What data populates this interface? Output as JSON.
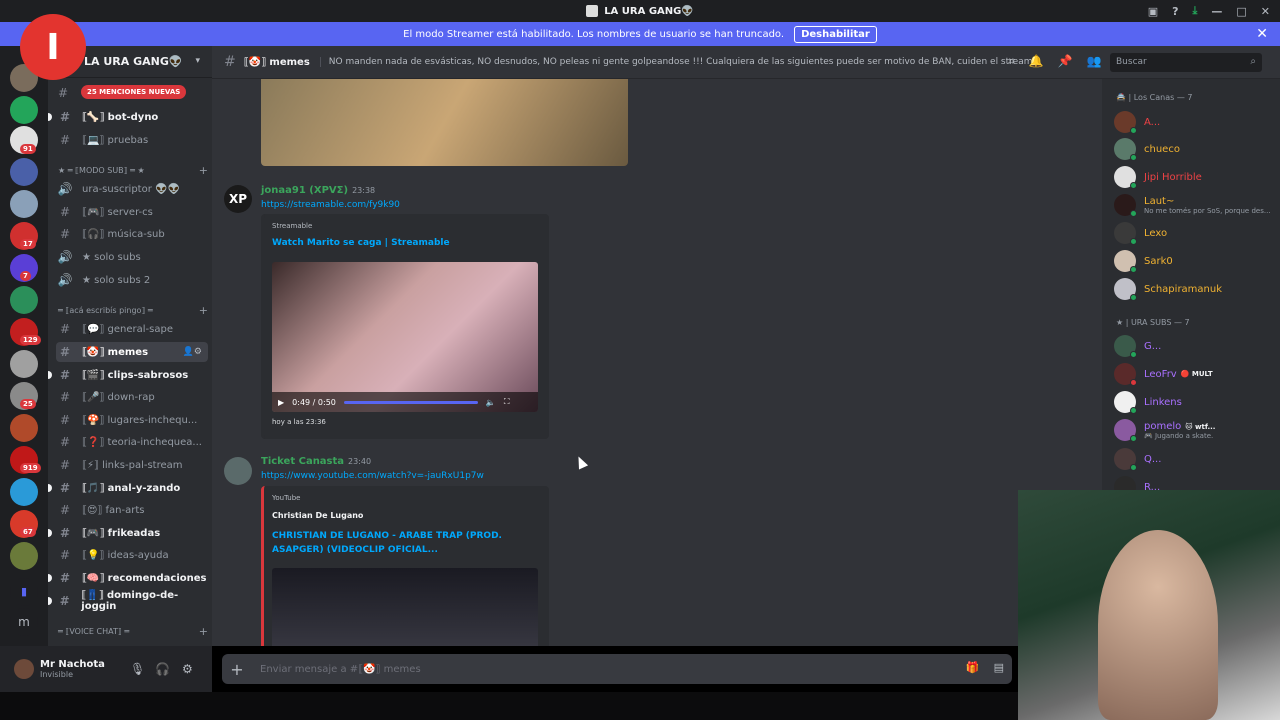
{
  "titlebar": {
    "title": "LA URA GANG👽"
  },
  "banner": {
    "text": "El modo Streamer está habilitado. Los nombres de usuario se han truncado.",
    "button": "Deshabilitar"
  },
  "guild_badges": [
    "91",
    "17",
    "7",
    "129",
    "25",
    "919",
    "67"
  ],
  "sidebar": {
    "server_name": "LA URA GANG👽",
    "mentions": "25 MENCIONES NUEVAS",
    "channels_top": [
      {
        "label": "⟦🦴⟧ bot-dyno",
        "unread": true
      },
      {
        "label": "⟦💻⟧ pruebas",
        "unread": false
      }
    ],
    "cat_sub": "★ ═ ⟦MODO SUB⟧ ═ ★",
    "channels_sub": [
      {
        "label": "ura-suscriptor 👽👽",
        "unread": false
      },
      {
        "label": "⟦🎮⟧ server-cs",
        "unread": false
      },
      {
        "label": "⟦🎧⟧ música-sub",
        "unread": false
      },
      {
        "label": "★ solo subs",
        "unread": false
      },
      {
        "label": "★ solo subs 2",
        "unread": false
      }
    ],
    "cat_pingo": "═ ⟦acá escribís pingo⟧ ═",
    "channels_pingo": [
      {
        "label": "⟦💬⟧ general-sape",
        "unread": false
      },
      {
        "label": "⟦🤡⟧ memes",
        "unread": true,
        "active": true
      },
      {
        "label": "⟦🎬⟧ clips-sabrosos",
        "unread": true
      },
      {
        "label": "⟦🎤⟧ down-rap",
        "unread": false
      },
      {
        "label": "⟦🍄⟧ lugares-inchequ...",
        "unread": false
      },
      {
        "label": "⟦❓⟧ teoria-inchequea...",
        "unread": false
      },
      {
        "label": "⟦⚡⟧ links-pal-stream",
        "unread": false
      },
      {
        "label": "⟦🎵⟧ anal-y-zando",
        "unread": true
      },
      {
        "label": "⟦😍⟧ fan-arts",
        "unread": false
      },
      {
        "label": "⟦🎮⟧ frikeadas",
        "unread": true
      },
      {
        "label": "⟦💡⟧ ideas-ayuda",
        "unread": false
      },
      {
        "label": "⟦🧠⟧ recomendaciones",
        "unread": true
      },
      {
        "label": "⟦👖⟧ domingo-de-joggin",
        "unread": true
      }
    ],
    "cat_voice": "═ ⟦VOICE CHAT⟧ ═"
  },
  "user": {
    "name": "Mr Nachota",
    "status": "Invisible"
  },
  "header": {
    "channel": "⟦🤡⟧ memes",
    "topic": "NO manden nada de esvásticas, NO desnudos, NO peleas ni gente golpeandose !!! Cualquiera de las siguientes puede ser motivo de BAN, cuiden el stream!",
    "search_placeholder": "Buscar"
  },
  "messages": [
    {
      "author": "jonaa91 (XPVΣ)",
      "time": "23:38",
      "color": "#3ba55c",
      "link": "https://streamable.com/fy9k90",
      "provider": "Streamable",
      "title": "Watch Marito se caga | Streamable",
      "video_time": "0:49 / 0:50",
      "footer": "hoy a las 23:36"
    },
    {
      "author": "Ticket Canasta",
      "time": "23:40",
      "color": "#3ba55c",
      "link": "https://www.youtube.com/watch?v=-jauRxU1p7w",
      "provider": "YouTube",
      "embed_author": "Christian De Lugano",
      "title": "CHRISTIAN DE LUGANO - ARABE TRAP (PROD. ASAPGER) (VIDEOCLIP OFICIAL..."
    }
  ],
  "input": {
    "placeholder": "Enviar mensaje a #⟦🤡⟧ memes"
  },
  "members": {
    "cat1": "🚔 | Los Canas — 7",
    "group1": [
      {
        "name": "A...",
        "color": "#ed4245"
      },
      {
        "name": "chueco",
        "color": "#f0b232"
      },
      {
        "name": "Jipi Horrible",
        "color": "#ed4245"
      },
      {
        "name": "Laut~",
        "color": "#f0b232",
        "status": "No me tomés por SoS, porque des..."
      },
      {
        "name": "Lexo",
        "color": "#f0b232"
      },
      {
        "name": "Sark0",
        "color": "#f0b232"
      },
      {
        "name": "Schapiramanuk",
        "color": "#f0b232"
      }
    ],
    "cat2": "★ | URA SUBS — 7",
    "group2": [
      {
        "name": "G...",
        "color": "#a970ff"
      },
      {
        "name": "LeoFrv",
        "color": "#a970ff",
        "tag": "🔴 MULT"
      },
      {
        "name": "Linkens",
        "color": "#a970ff"
      },
      {
        "name": "pomelo",
        "color": "#a970ff",
        "tag": "🐱 wtf...",
        "status": "🎮 Jugando a skate."
      },
      {
        "name": "Q...",
        "color": "#a970ff"
      },
      {
        "name": "R...",
        "color": "#a970ff"
      }
    ]
  },
  "colors": {
    "accent": "#5865f2",
    "link": "#00a8fc",
    "online": "#23a55a"
  }
}
